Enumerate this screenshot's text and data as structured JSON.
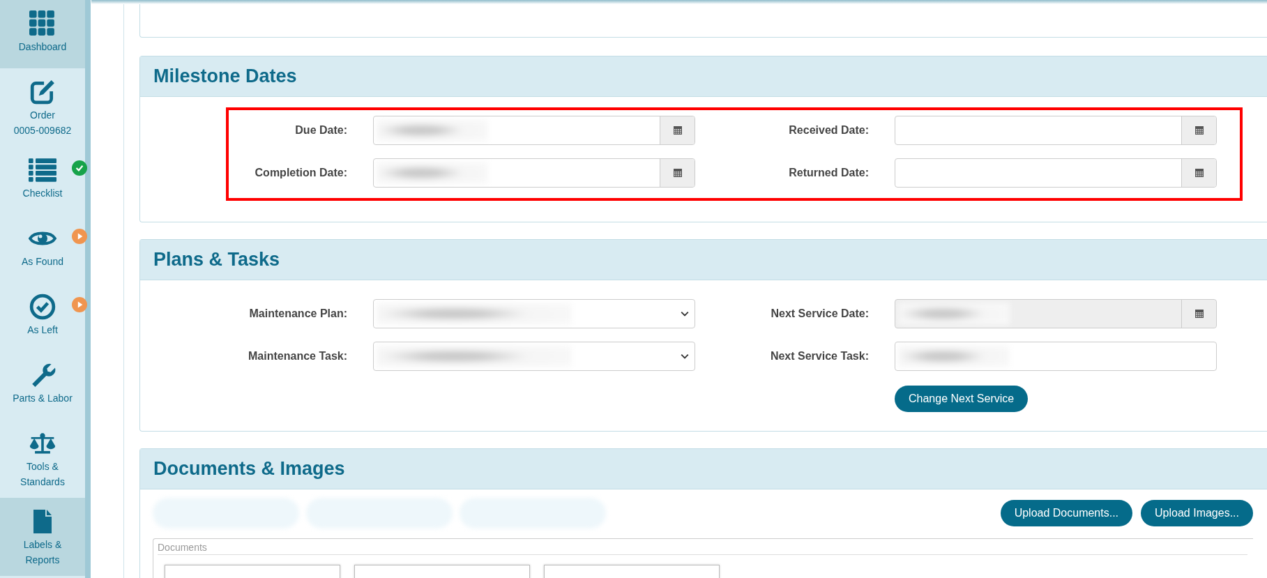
{
  "sidebar": {
    "items": [
      {
        "label": "Dashboard",
        "selected": true
      },
      {
        "label": "Order\n0005-009682",
        "selected": false
      },
      {
        "label": "Checklist",
        "selected": false,
        "badge": {
          "kind": "check",
          "color": "#16a34a"
        }
      },
      {
        "label": "As Found",
        "selected": false,
        "badge": {
          "kind": "play",
          "color": "#f0954f"
        }
      },
      {
        "label": "As Left",
        "selected": false,
        "badge": {
          "kind": "play",
          "color": "#f0954f"
        }
      },
      {
        "label": "Parts & Labor",
        "selected": false
      },
      {
        "label": "Tools &\nStandards",
        "selected": false
      },
      {
        "label": "Labels &\nReports",
        "selected": true
      }
    ]
  },
  "milestone_dates": {
    "title": "Milestone Dates",
    "highlighted": true,
    "fields": [
      {
        "label": "Due Date:",
        "kind": "date",
        "redacted": true
      },
      {
        "label": "Received Date:",
        "kind": "date",
        "redacted": false
      },
      {
        "label": "Completion Date:",
        "kind": "date",
        "redacted": true
      },
      {
        "label": "Returned Date:",
        "kind": "date",
        "redacted": false
      }
    ]
  },
  "plans_tasks": {
    "title": "Plans & Tasks",
    "fields": [
      {
        "label": "Maintenance Plan:",
        "kind": "select",
        "redacted": true
      },
      {
        "label": "Next Service Date:",
        "kind": "date",
        "redacted": true,
        "disabled": true
      },
      {
        "label": "Maintenance Task:",
        "kind": "select",
        "redacted": true
      },
      {
        "label": "Next Service Task:",
        "kind": "text",
        "redacted": true
      }
    ],
    "button": "Change Next Service"
  },
  "documents_images": {
    "title": "Documents & Images",
    "template_buttons": [
      {
        "redacted": true
      },
      {
        "redacted": true
      },
      {
        "redacted": true
      }
    ],
    "buttons": [
      "Upload Documents...",
      "Upload Images..."
    ],
    "documents_label": "Documents"
  }
}
